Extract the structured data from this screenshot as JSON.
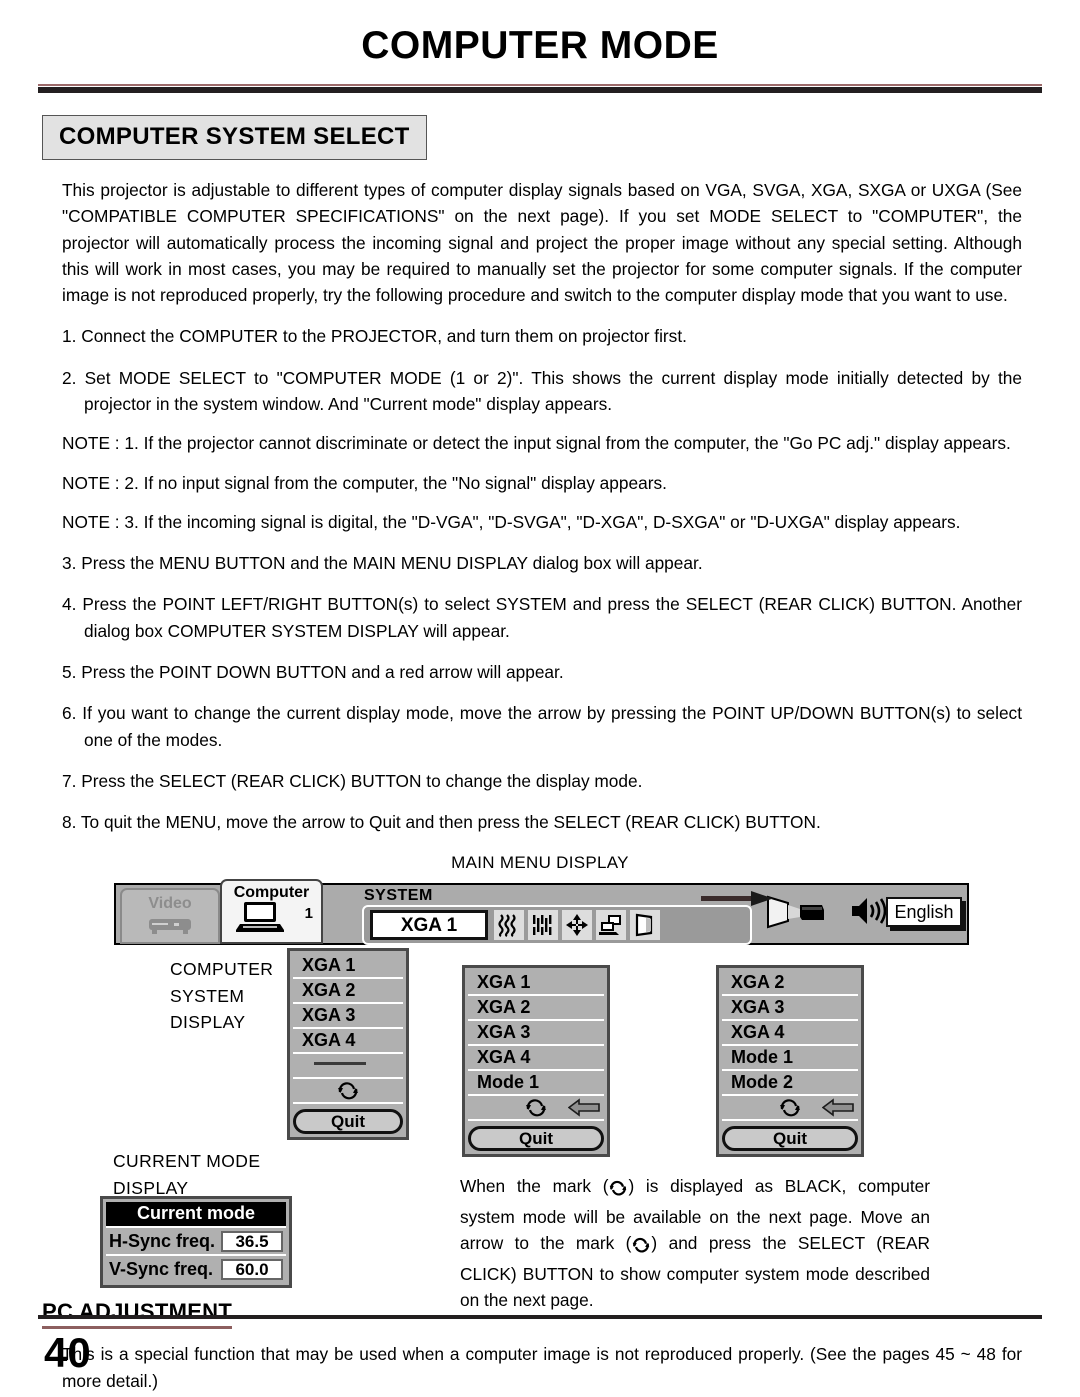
{
  "page": {
    "title": "COMPUTER MODE",
    "number": "40"
  },
  "section": {
    "label": "COMPUTER SYSTEM SELECT",
    "intro": "This projector is adjustable to different types of computer display signals based on VGA, SVGA, XGA, SXGA or UXGA (See \"COMPATIBLE COMPUTER SPECIFICATIONS\" on the next page). If you set MODE SELECT to \"COMPUTER\", the projector will automatically process the incoming signal and project the proper image without any special setting. Although this will work in most cases, you may be required to manually set the projector for some computer signals. If the computer image is not reproduced properly, try the following procedure and switch to the computer display mode that you want to use."
  },
  "steps": [
    "1. Connect the COMPUTER to the PROJECTOR, and turn them on projector first.",
    "2. Set MODE SELECT to \"COMPUTER MODE (1 or 2)\". This shows the current display mode initially detected by the projector in the system window. And \"Current mode\" display appears.",
    "3. Press the MENU BUTTON and the MAIN MENU DISPLAY dialog box will appear.",
    "4. Press the POINT LEFT/RIGHT BUTTON(s) to select SYSTEM and press the SELECT (REAR CLICK) BUTTON. Another dialog box COMPUTER SYSTEM DISPLAY will appear.",
    "5. Press the POINT DOWN BUTTON and a red arrow will appear.",
    "6. If you want to change the current display mode, move the arrow by pressing the POINT UP/DOWN BUTTON(s) to select one of the modes.",
    "7. Press the SELECT (REAR CLICK) BUTTON to change the display mode.",
    "8. To quit the MENU, move the arrow to Quit and then press the SELECT (REAR CLICK) BUTTON."
  ],
  "notes": [
    "NOTE : 1. If the projector cannot discriminate or detect the input signal from the computer, the \"Go PC adj.\" display appears.",
    "NOTE : 2. If no input signal from the computer, the \"No signal\" display appears.",
    "NOTE : 3. If the incoming signal is digital, the \"D-VGA\", \"D-SVGA\", \"D-XGA\", D-SXGA\" or \"D-UXGA\" display appears."
  ],
  "diagram": {
    "main_menu_caption": "MAIN MENU DISPLAY",
    "computer_system_display_caption": "COMPUTER\nSYSTEM\nDISPLAY",
    "current_mode_display_caption": "CURRENT MODE\nDISPLAY",
    "menubar": {
      "tab_video": "Video",
      "tab_computer": "Computer",
      "tab_computer_number": "1",
      "system_label": "SYSTEM",
      "current_system": "XGA 1",
      "language": "English",
      "icons": [
        "wave-pattern-icon",
        "fine-sync-icon",
        "position-arrows-icon",
        "pc-adjust-icon",
        "screen-image-icon",
        "projector-icon",
        "sound-icon"
      ]
    },
    "list_box_1": {
      "items": [
        "XGA 1",
        "XGA 2",
        "XGA 3",
        "XGA 4"
      ],
      "separator": "—",
      "cycle_icon": "cycle-mark-icon",
      "quit": "Quit",
      "arrow_on_index": 0
    },
    "list_box_2": {
      "items": [
        "XGA 1",
        "XGA 2",
        "XGA 3",
        "XGA 4",
        "Mode 1"
      ],
      "cycle_icon": "cycle-mark-icon",
      "quit": "Quit",
      "arrow_on_cycle": true
    },
    "list_box_3": {
      "items": [
        "XGA 2",
        "XGA 3",
        "XGA 4",
        "Mode 1",
        "Mode 2"
      ],
      "cycle_icon": "cycle-mark-icon",
      "quit": "Quit",
      "arrow_on_cycle": true
    },
    "current_mode": {
      "title": "Current mode",
      "rows": [
        {
          "name": "H-Sync freq.",
          "value": "36.5"
        },
        {
          "name": "V-Sync freq.",
          "value": "60.0"
        }
      ]
    },
    "explanation_parts": {
      "p1": "When the mark (",
      "p2": ") is displayed as BLACK, computer system mode will be available on the next page. Move an arrow to the mark (",
      "p3": ") and press the SELECT (REAR CLICK) BUTTON to show computer system mode described on the next page."
    }
  },
  "pc_adjustment": {
    "heading": "PC ADJUSTMENT",
    "body": "This is a special function that may be used when a computer image is not reproduced properly. (See the pages 45 ~ 48 for more detail.)"
  },
  "colors": {
    "rule_red": "#9c6a6a",
    "rule_dark": "#231f20",
    "panel_gray": "#b0b0b0",
    "menubar_gray": "#ababab"
  }
}
